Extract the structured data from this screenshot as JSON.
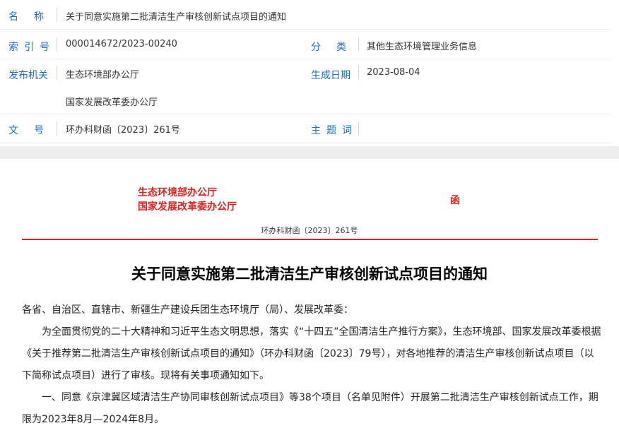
{
  "meta": {
    "name_label": "名称",
    "name_value": "关于同意实施第二批清洁生产审核创新试点项目的通知",
    "index_label": "索引号",
    "index_value": "000014672/2023-00240",
    "category_label": "分类",
    "category_value": "其他生态环境管理业务信息",
    "issuer_label": "发布机关",
    "issuer_value_1": "生态环境部办公厅",
    "issuer_value_2": "国家发展改革委办公厅",
    "date_label": "生成日期",
    "date_value": "2023-08-04",
    "docno_label": "文号",
    "docno_value": "环办科财函〔2023〕261号",
    "topic_label": "主题词",
    "topic_value": ""
  },
  "document": {
    "issuer_1": "生态环境部办公厅",
    "issuer_2": "国家发展改革委办公厅",
    "han": "函",
    "doc_number": "环办科财函〔2023〕261号",
    "title": "关于同意实施第二批清洁生产审核创新试点项目的通知",
    "addressee": "各省、自治区、直辖市、新疆生产建设兵团生态环境厅（局）、发展改革委：",
    "paragraph_1": "为全面贯彻党的二十大精神和习近平生态文明思想，落实《“十四五”全国清洁生产推行方案》，生态环境部、国家发展改革委根据《关于推荐第二批清洁生产审核创新试点项目的通知》（环办科财函〔2023〕79号），对各地推荐的清洁生产审核创新试点项目（以下简称试点项目）进行了审核。现将有关事项通知如下。",
    "paragraph_2": "一、同意《京津冀区域清洁生产协同审核创新试点项目》等38个项目（名单见附件）开展第二批清洁生产审核创新试点工作，期限为2023年8月—2024年8月。"
  },
  "colors": {
    "label_blue": "#1d6fc5",
    "red": "#e02020"
  }
}
